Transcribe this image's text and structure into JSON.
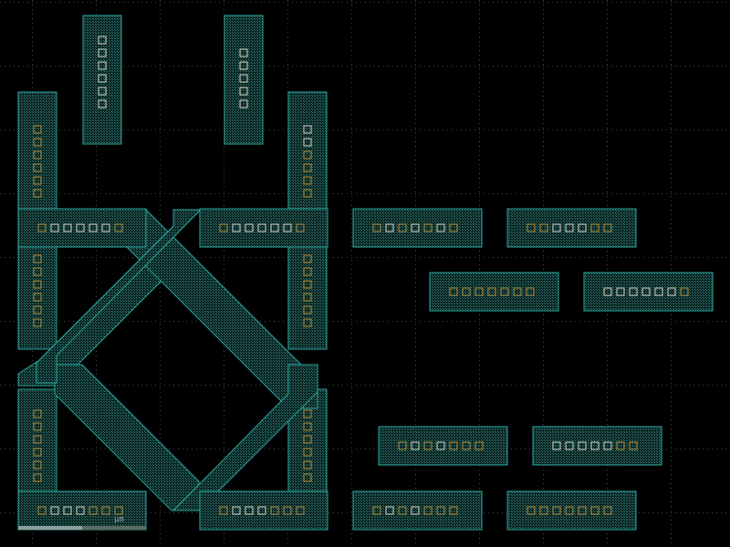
{
  "view": {
    "background_color": "#000000",
    "grid_dot_color": "#3f4a52",
    "wire_stroke_color": "#2aa7a0",
    "wire_hatch_color": "#1f6f6a",
    "contact_color": "#b48d3a",
    "contact_highlight_color": "#d9d2c6"
  },
  "scale": {
    "label": "µm"
  },
  "layout": {
    "vertical_stubs_count": 2,
    "vertical_columns_count": 4,
    "horizontal_rails_count": 4,
    "diagonal_crossings_count": 2,
    "standalone_horizontal_bars_count": 8
  }
}
